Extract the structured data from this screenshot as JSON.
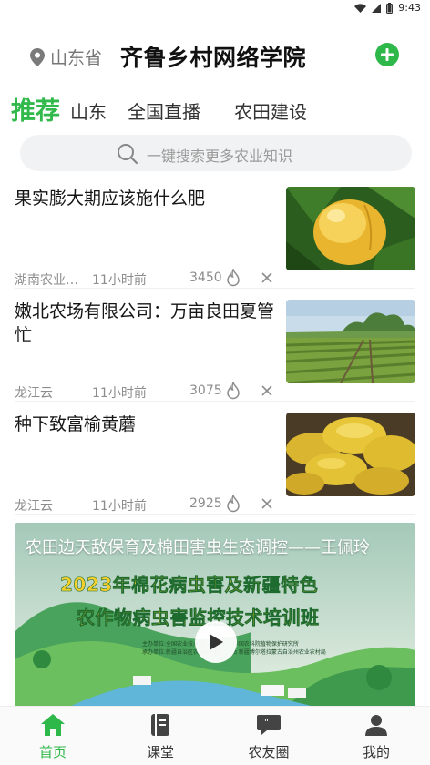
{
  "status_bar": {
    "time": "9:43"
  },
  "header": {
    "location": "山东省",
    "title": "齐鲁乡村网络学院"
  },
  "tabs": [
    {
      "label": "推荐",
      "active": true
    },
    {
      "label": "山东"
    },
    {
      "label": "全国直播"
    },
    {
      "label": "农田建设"
    }
  ],
  "search": {
    "placeholder": "一键搜索更多农业知识"
  },
  "news": [
    {
      "title": "果实膨大期应该施什么肥",
      "source": "湖南农业…",
      "time": "11小时前",
      "count": "3450"
    },
    {
      "title": "嫩北农场有限公司：万亩良田夏管忙",
      "source": "龙江云",
      "time": "11小时前",
      "count": "3075"
    },
    {
      "title": "种下致富榆黄蘑",
      "source": "龙江云",
      "time": "11小时前",
      "count": "2925"
    }
  ],
  "video": {
    "title": "农田边天敌保育及棉田害虫生态调控——王佩玲",
    "banner_line1": "2023年棉花病虫害及新疆特色",
    "banner_line2": "农作物病虫害监控技术培训班",
    "organizer_line1": "主办单位:全国农业技术推广服务中心 中国农科院植物保护研究所",
    "organizer_line2": "承办单位:新疆自治区农业技术推广总站 新疆博尔塔拉蒙古自治州农业农村局"
  },
  "bottom_nav": [
    {
      "label": "首页",
      "icon": "home-icon",
      "active": true
    },
    {
      "label": "课堂",
      "icon": "book-icon"
    },
    {
      "label": "农友圈",
      "icon": "chat-icon"
    },
    {
      "label": "我的",
      "icon": "user-icon"
    }
  ],
  "colors": {
    "accent": "#2fb84a",
    "muted_text": "#8c8c8c",
    "search_bg": "#f1f2f3"
  }
}
